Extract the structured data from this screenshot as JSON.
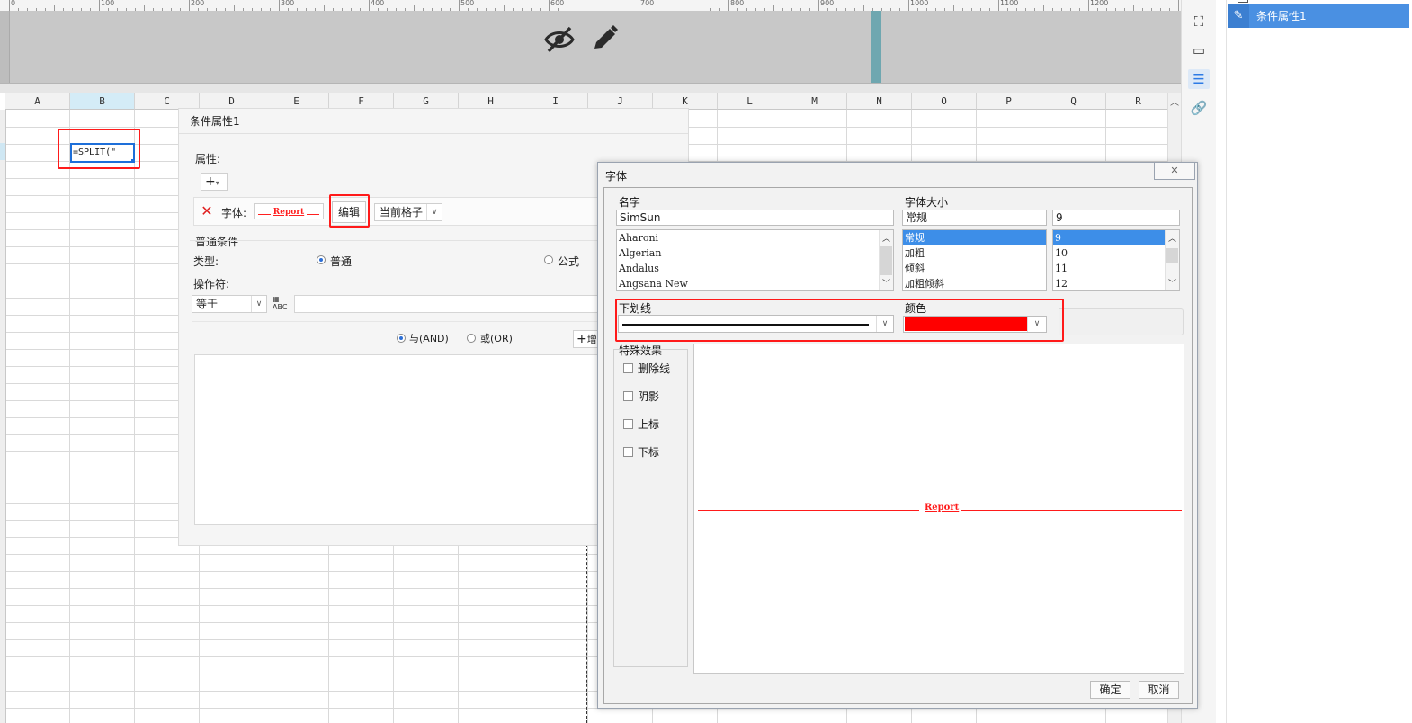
{
  "ruler": {
    "labels": [
      "0",
      "100",
      "200",
      "300",
      "400",
      "500",
      "600",
      "700",
      "800",
      "900",
      "1000",
      "1100",
      "1200"
    ]
  },
  "sheet": {
    "columns": [
      "A",
      "B",
      "C",
      "D",
      "E",
      "F",
      "G",
      "H",
      "I",
      "J",
      "K",
      "L",
      "M",
      "N",
      "O",
      "P",
      "Q",
      "R"
    ],
    "selected_column": "B",
    "cell_value": "=SPLIT(\""
  },
  "right_panel": {
    "item_label": "条件属性1"
  },
  "condition_panel": {
    "title": "条件属性1",
    "property_label": "属性:",
    "add_icon": "plus-icon",
    "font_label": "字体:",
    "font_preview": "Report",
    "edit_button": "编辑",
    "scope_value": "当前格子",
    "normal_condition_label": "普通条件",
    "type_label": "类型:",
    "type_options": {
      "normal": "普通",
      "formula": "公式"
    },
    "type_selected": "normal",
    "operator_label": "操作符:",
    "operator_value": "等于",
    "abc_icon": "ABC",
    "logic": {
      "and": "与(AND)",
      "or": "或(OR)",
      "selected": "and"
    },
    "add_condition_icon": "plus-icon",
    "add_condition_label": "增"
  },
  "font_dialog": {
    "title": "字体",
    "name_label": "名字",
    "name_value": "SimSun",
    "font_list": [
      "Aharoni",
      "Algerian",
      "Andalus",
      "Angsana New"
    ],
    "size_label": "字体大小",
    "style_value": "常规",
    "style_list": [
      "常规",
      "加粗",
      "倾斜",
      "加粗倾斜"
    ],
    "style_selected": 0,
    "size_value": "9",
    "size_list": [
      "9",
      "10",
      "11",
      "12"
    ],
    "size_selected": 0,
    "underline_label": "下划线",
    "color_label": "颜色",
    "color_value": "#ff0000",
    "effects_label": "特殊效果",
    "effects": [
      "删除线",
      "阴影",
      "上标",
      "下标"
    ],
    "preview_text": "Report",
    "ok_button": "确定",
    "cancel_button": "取消"
  }
}
